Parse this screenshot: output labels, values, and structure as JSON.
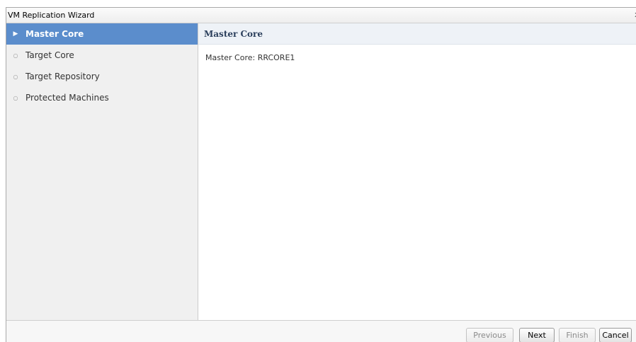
{
  "window": {
    "title": "VM Replication Wizard",
    "close_glyph": "x"
  },
  "sidebar": {
    "steps": [
      {
        "label": "Master Core",
        "active": true,
        "marker": "▶",
        "icon": "play-arrow-icon"
      },
      {
        "label": "Target Core",
        "active": false,
        "marker": "○",
        "icon": "hollow-circle-icon"
      },
      {
        "label": "Target Repository",
        "active": false,
        "marker": "○",
        "icon": "hollow-circle-icon"
      },
      {
        "label": "Protected Machines",
        "active": false,
        "marker": "○",
        "icon": "hollow-circle-icon"
      }
    ]
  },
  "content": {
    "heading": "Master Core",
    "master_core_line": "Master Core: RRCORE1"
  },
  "footer": {
    "previous_label": "Previous",
    "next_label": "Next",
    "finish_label": "Finish",
    "cancel_label": "Cancel"
  },
  "colors": {
    "active_step_bg": "#5b8dcc",
    "sidebar_bg": "#f0f0f0",
    "heading_text": "#2b3f5c"
  }
}
